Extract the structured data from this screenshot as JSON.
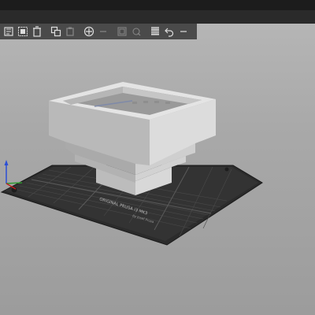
{
  "app": {
    "accent": "#ed6b21",
    "background": "#a9a9a9"
  },
  "toolbar": {
    "buttons": [
      {
        "icon": "add-icon"
      },
      {
        "icon": "delete-icon"
      },
      {
        "icon": "delete-all-icon"
      },
      {
        "icon": "arrange-icon"
      },
      {
        "icon": "copy-icon"
      },
      {
        "icon": "paste-icon"
      },
      {
        "icon": "add-instance-icon"
      },
      {
        "icon": "remove-instance-icon"
      },
      {
        "icon": "split-objects-icon"
      },
      {
        "icon": "split-parts-icon"
      },
      {
        "icon": "layer-editing-icon"
      },
      {
        "icon": "undo-icon"
      },
      {
        "icon": "redo-icon"
      }
    ]
  },
  "bed": {
    "brand_text": "ORIGINAL PRUSA i3 MK3",
    "sub_text": "by Josef Prusa",
    "color": "#2e2e2e"
  },
  "model": {
    "color": "#c8c8c8"
  }
}
